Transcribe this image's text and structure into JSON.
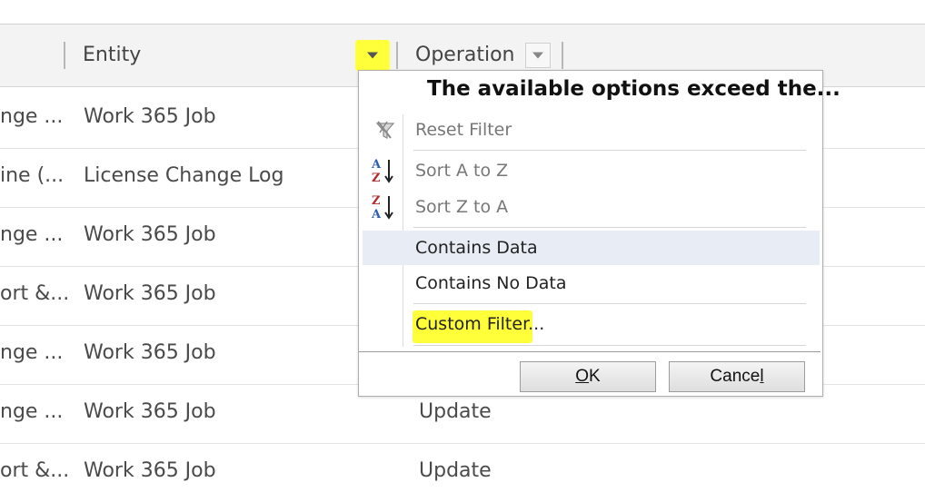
{
  "grid": {
    "columns": {
      "entity": "Entity",
      "operation": "Operation"
    },
    "rows": [
      {
        "col1": "nge ...",
        "entity": "Work 365 Job",
        "operation": ""
      },
      {
        "col1": "ine (...",
        "entity": "License Change Log",
        "operation": ""
      },
      {
        "col1": "nge ...",
        "entity": "Work 365 Job",
        "operation": ""
      },
      {
        "col1": "ort &...",
        "entity": "Work 365 Job",
        "operation": ""
      },
      {
        "col1": "nge ...",
        "entity": "Work 365 Job",
        "operation": ""
      },
      {
        "col1": "nge ...",
        "entity": "Work 365 Job",
        "operation": "Update"
      },
      {
        "col1": "ort &...",
        "entity": "Work 365 Job",
        "operation": "Update"
      }
    ]
  },
  "filter_menu": {
    "title": "The available options exceed the...",
    "items": {
      "reset": "Reset Filter",
      "sort_az": "Sort A to Z",
      "sort_za": "Sort Z to A",
      "contains_data": "Contains Data",
      "contains_no_data": "Contains No Data",
      "custom": "Custom Filter..."
    },
    "buttons": {
      "ok_underlined": "O",
      "ok_rest": "K",
      "cancel_start": "Cance",
      "cancel_underlined": "l"
    }
  },
  "colors": {
    "highlight": "#ffff3a",
    "selected_row": "#e8edf5"
  },
  "icons": {
    "filter": "dropdown-triangle-icon",
    "reset": "clear-filter-funnel-icon",
    "sort_az": "sort-ascending-icon",
    "sort_za": "sort-descending-icon"
  }
}
